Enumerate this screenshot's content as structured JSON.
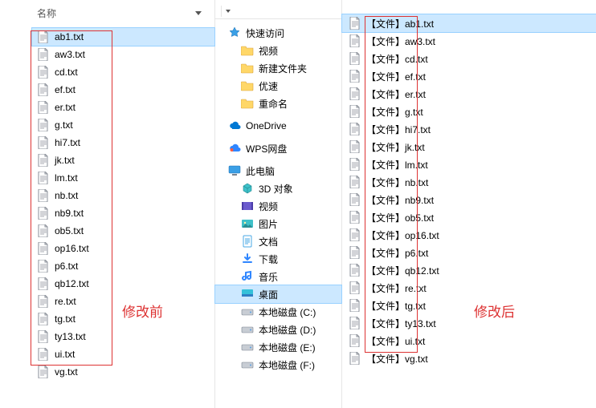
{
  "left": {
    "column_header": "名称",
    "files": [
      "ab1.txt",
      "aw3.txt",
      "cd.txt",
      "ef.txt",
      "er.txt",
      "g.txt",
      "hi7.txt",
      "jk.txt",
      "lm.txt",
      "nb.txt",
      "nb9.txt",
      "ob5.txt",
      "op16.txt",
      "p6.txt",
      "qb12.txt",
      "re.txt",
      "tg.txt",
      "ty13.txt",
      "ui.txt",
      "vg.txt"
    ],
    "selected_index": 0
  },
  "annotations": {
    "before": "修改前",
    "after": "修改后"
  },
  "nav": {
    "quick_access": {
      "label": "快速访问",
      "icon": "star-icon"
    },
    "quick_children": [
      {
        "label": "视频",
        "icon": "folder-icon"
      },
      {
        "label": "新建文件夹",
        "icon": "folder-icon"
      },
      {
        "label": "优速",
        "icon": "folder-icon"
      },
      {
        "label": "重命名",
        "icon": "folder-icon"
      }
    ],
    "onedrive": "OneDrive",
    "wps": "WPS网盘",
    "this_pc": "此电脑",
    "pc_children": [
      {
        "label": "3D 对象",
        "icon": "objects3d-icon"
      },
      {
        "label": "视频",
        "icon": "videos-icon"
      },
      {
        "label": "图片",
        "icon": "pictures-icon"
      },
      {
        "label": "文档",
        "icon": "documents-icon"
      },
      {
        "label": "下载",
        "icon": "downloads-icon"
      },
      {
        "label": "音乐",
        "icon": "music-icon"
      },
      {
        "label": "桌面",
        "icon": "desktop-icon"
      },
      {
        "label": "本地磁盘 (C:)",
        "icon": "drive-icon"
      },
      {
        "label": "本地磁盘 (D:)",
        "icon": "drive-icon"
      },
      {
        "label": "本地磁盘 (E:)",
        "icon": "drive-icon"
      },
      {
        "label": "本地磁盘 (F:)",
        "icon": "drive-icon"
      }
    ],
    "selected_label": "桌面"
  },
  "right": {
    "prefix": "【文件】",
    "files": [
      "ab1.txt",
      "aw3.txt",
      "cd.txt",
      "ef.txt",
      "er.txt",
      "g.txt",
      "hi7.txt",
      "jk.txt",
      "lm.txt",
      "nb.txt",
      "nb9.txt",
      "ob5.txt",
      "op16.txt",
      "p6.txt",
      "qb12.txt",
      "re.txt",
      "tg.txt",
      "ty13.txt",
      "ui.txt",
      "vg.txt"
    ],
    "selected_index": 0
  }
}
